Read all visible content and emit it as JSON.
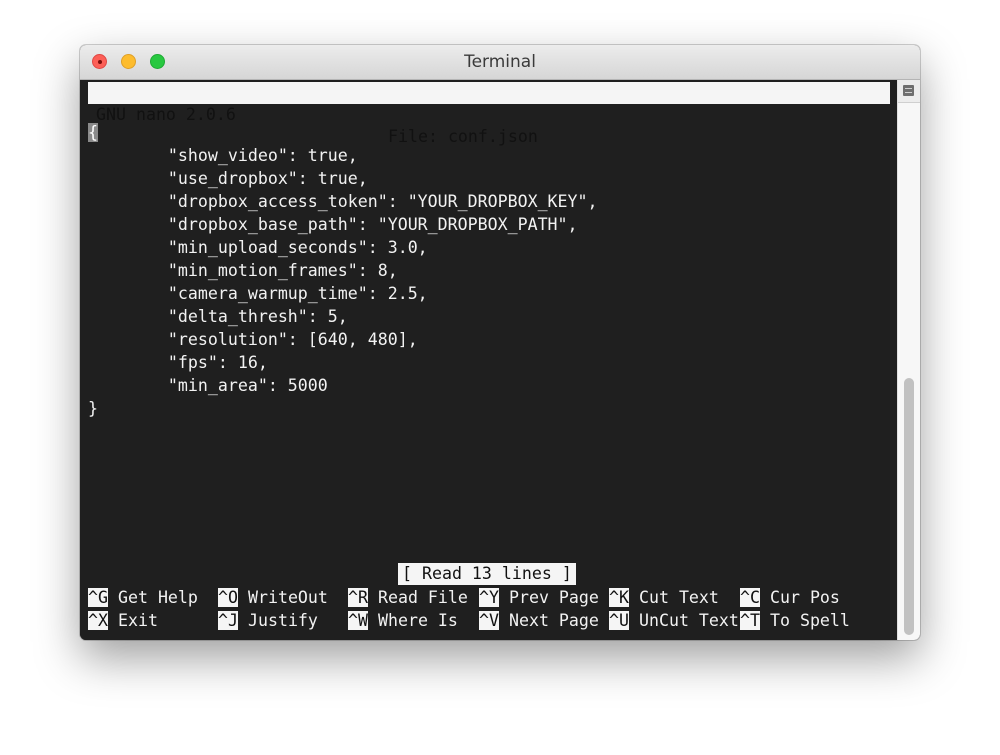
{
  "window": {
    "title": "Terminal"
  },
  "nano": {
    "version": "GNU nano 2.0.6",
    "file": "File: conf.json",
    "status_message": "[ Read 13 lines ]",
    "scroll_position_fraction": 0.54,
    "lines": [
      "{",
      "        \"show_video\": true,",
      "        \"use_dropbox\": true,",
      "        \"dropbox_access_token\": \"YOUR_DROPBOX_KEY\",",
      "        \"dropbox_base_path\": \"YOUR_DROPBOX_PATH\",",
      "        \"min_upload_seconds\": 3.0,",
      "        \"min_motion_frames\": 8,",
      "        \"camera_warmup_time\": 2.5,",
      "        \"delta_thresh\": 5,",
      "        \"resolution\": [640, 480],",
      "        \"fps\": 16,",
      "        \"min_area\": 5000",
      "}"
    ],
    "shortcuts_row1": [
      {
        "key": "^G",
        "label": "Get Help"
      },
      {
        "key": "^O",
        "label": "WriteOut"
      },
      {
        "key": "^R",
        "label": "Read File"
      },
      {
        "key": "^Y",
        "label": "Prev Page"
      },
      {
        "key": "^K",
        "label": "Cut Text"
      },
      {
        "key": "^C",
        "label": "Cur Pos"
      }
    ],
    "shortcuts_row2": [
      {
        "key": "^X",
        "label": "Exit"
      },
      {
        "key": "^J",
        "label": "Justify"
      },
      {
        "key": "^W",
        "label": "Where Is"
      },
      {
        "key": "^V",
        "label": "Next Page"
      },
      {
        "key": "^U",
        "label": "UnCut Text"
      },
      {
        "key": "^T",
        "label": "To Spell"
      }
    ]
  }
}
